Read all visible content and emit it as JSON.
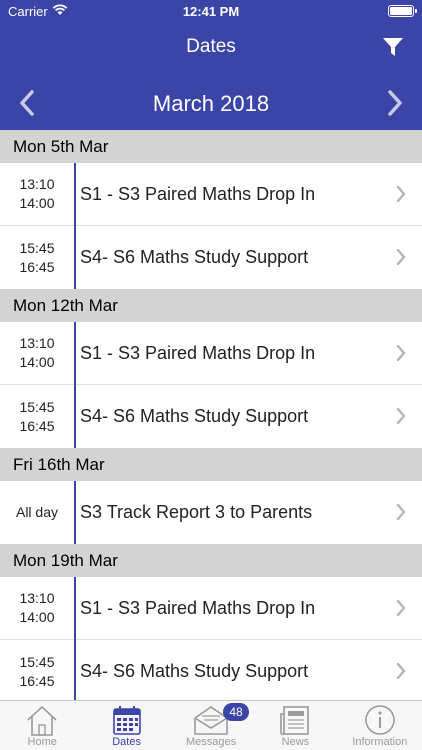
{
  "status_bar": {
    "carrier": "Carrier",
    "time": "12:41 PM"
  },
  "navbar": {
    "title": "Dates"
  },
  "month_bar": {
    "month": "March 2018"
  },
  "sections": [
    {
      "date": "Mon 5th Mar",
      "events": [
        {
          "start": "13:10",
          "end": "14:00",
          "title": "S1 - S3 Paired Maths Drop In"
        },
        {
          "start": "15:45",
          "end": "16:45",
          "title": "S4- S6 Maths Study Support"
        }
      ]
    },
    {
      "date": "Mon 12th Mar",
      "events": [
        {
          "start": "13:10",
          "end": "14:00",
          "title": "S1 - S3 Paired Maths Drop In"
        },
        {
          "start": "15:45",
          "end": "16:45",
          "title": "S4- S6 Maths Study Support"
        }
      ]
    },
    {
      "date": "Fri 16th Mar",
      "events": [
        {
          "allday": "All day",
          "title": "S3 Track Report 3 to Parents"
        }
      ]
    },
    {
      "date": "Mon 19th Mar",
      "events": [
        {
          "start": "13:10",
          "end": "14:00",
          "title": "S1 - S3 Paired Maths Drop In"
        },
        {
          "start": "15:45",
          "end": "16:45",
          "title": "S4- S6 Maths Study Support"
        }
      ]
    }
  ],
  "tabbar": {
    "home": "Home",
    "dates": "Dates",
    "messages": "Messages",
    "messages_badge": "48",
    "news": "News",
    "information": "Information"
  },
  "colors": {
    "accent": "#3b45a8",
    "section_bg": "#d3d3d3",
    "inactive": "#9a9a9a"
  },
  "icons": [
    "wifi-icon",
    "battery-icon",
    "filter-icon",
    "chevron-left-icon",
    "chevron-right-icon",
    "home-icon",
    "calendar-icon",
    "envelope-icon",
    "newspaper-icon",
    "info-icon"
  ]
}
